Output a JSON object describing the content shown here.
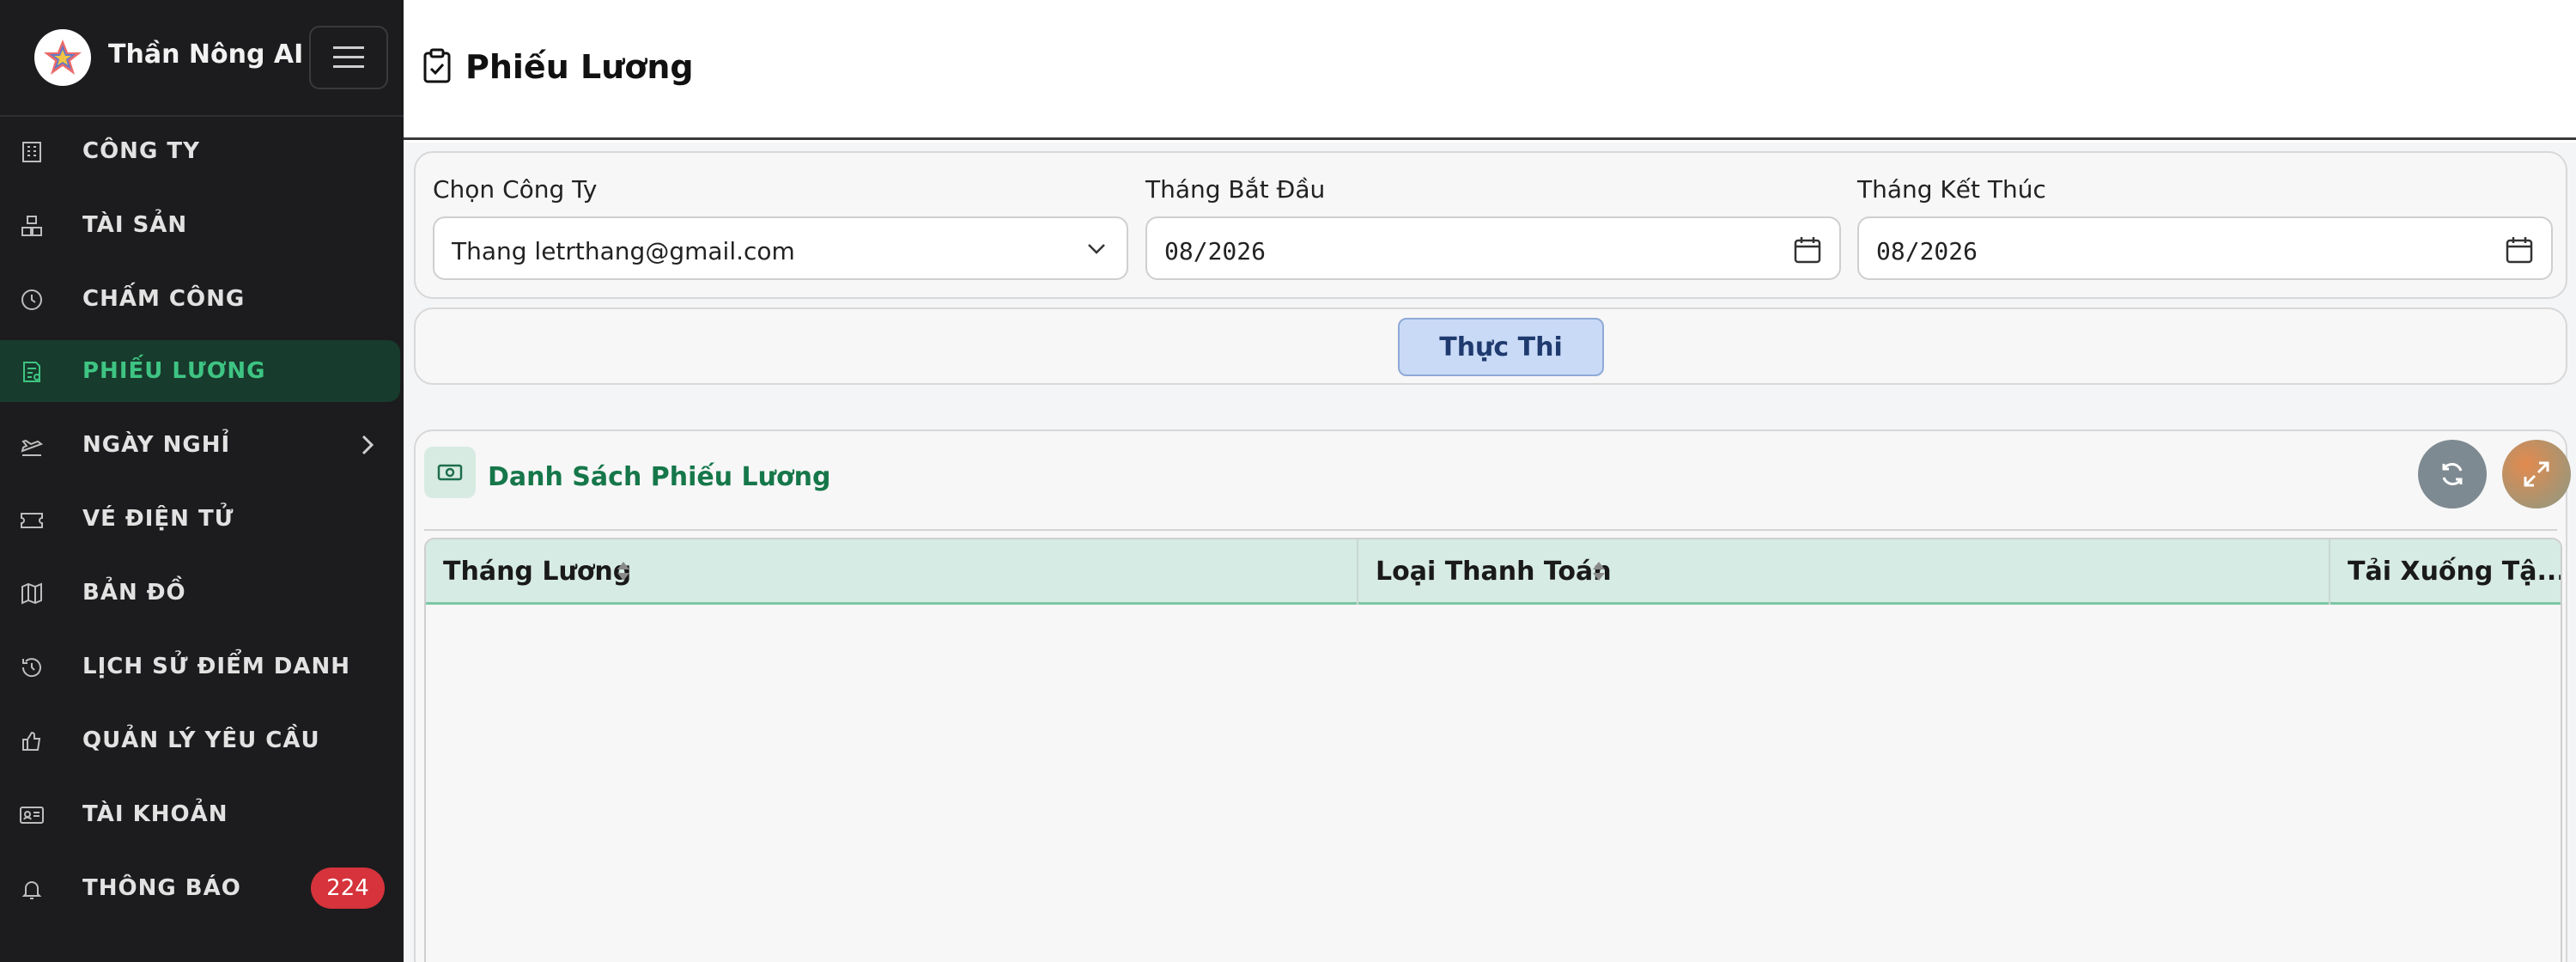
{
  "brand": {
    "name": "Thần Nông AI"
  },
  "header": {
    "title": "Phiếu Lương"
  },
  "sidebar": {
    "items": [
      {
        "label": "CÔNG TY",
        "icon": "building-icon"
      },
      {
        "label": "TÀI SẢN",
        "icon": "boxes-icon"
      },
      {
        "label": "CHẤM CÔNG",
        "icon": "clock-icon"
      },
      {
        "label": "PHIẾU LƯƠNG",
        "icon": "payslip-icon",
        "active": true
      },
      {
        "label": "NGÀY NGHỈ",
        "icon": "plane-icon",
        "has_submenu": true
      },
      {
        "label": "VÉ ĐIỆN TỬ",
        "icon": "ticket-icon"
      },
      {
        "label": "BẢN ĐỒ",
        "icon": "map-icon"
      },
      {
        "label": "LỊCH SỬ ĐIỂM DANH",
        "icon": "history-icon"
      },
      {
        "label": "QUẢN LÝ YÊU CẦU",
        "icon": "thumbs-up-icon"
      },
      {
        "label": "TÀI KHOẢN",
        "icon": "id-card-icon"
      },
      {
        "label": "THÔNG BÁO",
        "icon": "bell-icon",
        "badge": "224"
      }
    ]
  },
  "filters": {
    "company": {
      "label": "Chọn Công Ty",
      "value": "Thang letrthang@gmail.com"
    },
    "start_month": {
      "label": "Tháng Bắt Đầu",
      "value": "08/2026"
    },
    "end_month": {
      "label": "Tháng Kết Thúc",
      "value": "08/2026"
    }
  },
  "actions": {
    "run_label": "Thực Thi"
  },
  "list": {
    "title": "Danh Sách Phiếu Lương",
    "columns": [
      "Tháng Lương",
      "Loại Thanh Toán",
      "Tải Xuống Tậ..."
    ],
    "rows": []
  },
  "colors": {
    "sidebar_bg": "#1c1c1e",
    "accent_green": "#16774a",
    "active_green": "#3ec483",
    "badge_red": "#d6333c",
    "run_button_bg": "#c9daf7"
  }
}
